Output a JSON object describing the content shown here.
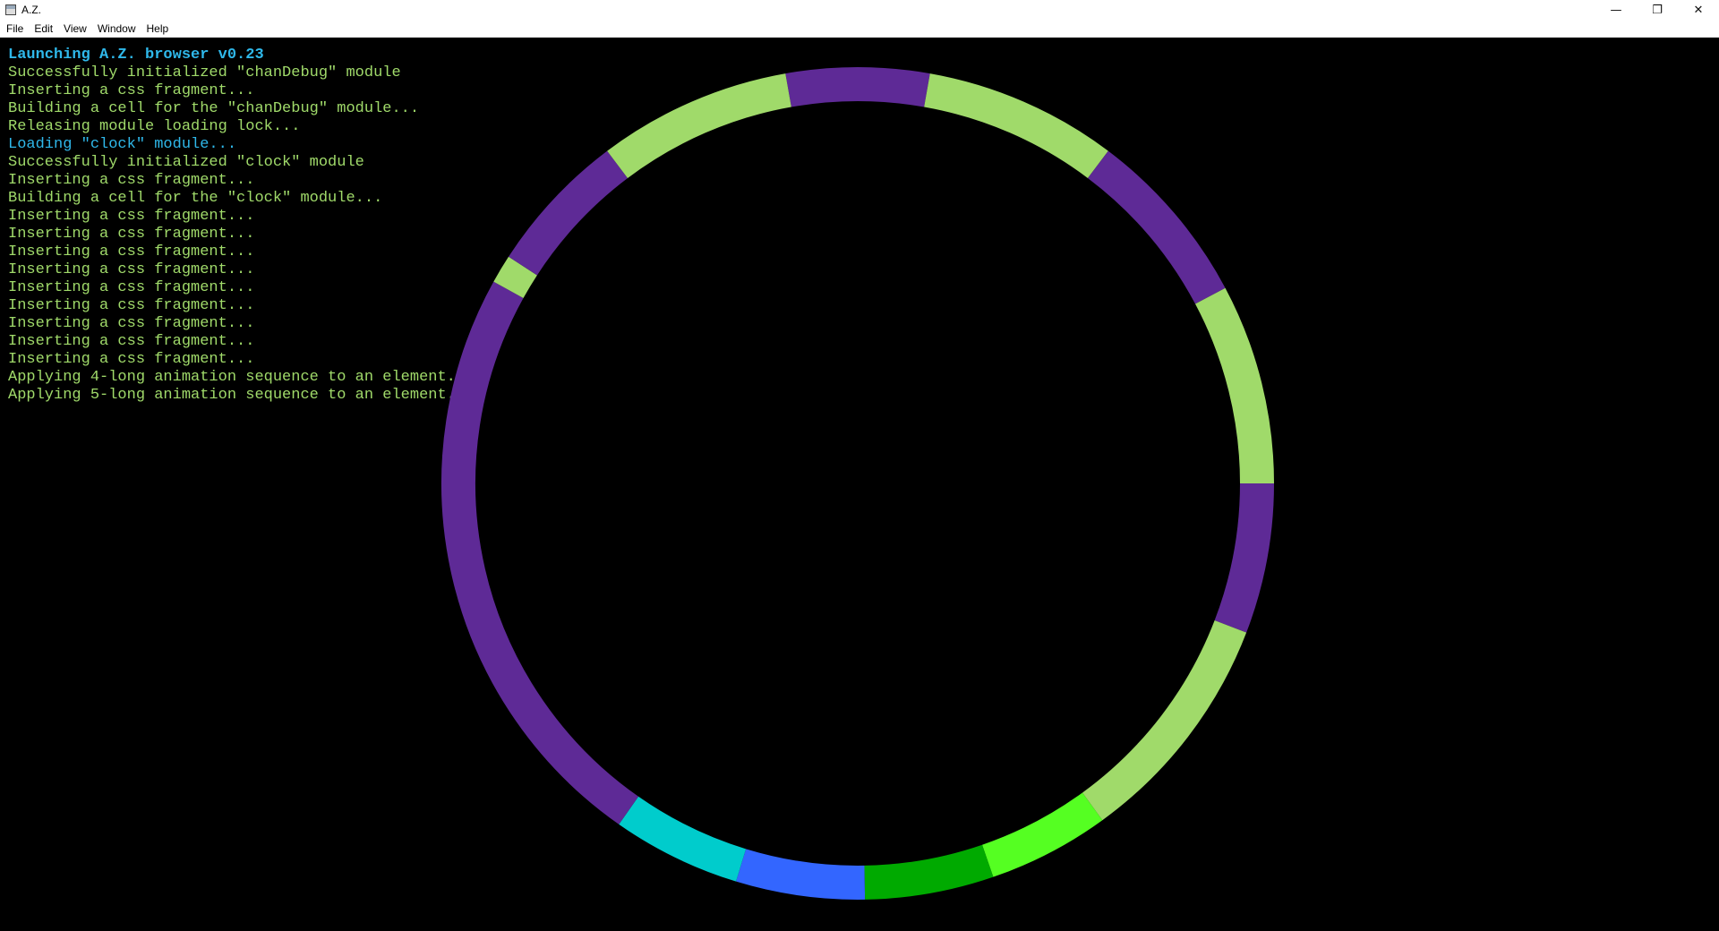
{
  "window": {
    "title": "A.Z.",
    "icon": "app-window-icon",
    "controls": {
      "minimize": "—",
      "restore": "❐",
      "close": "✕"
    }
  },
  "menu": {
    "items": [
      "File",
      "Edit",
      "View",
      "Window",
      "Help"
    ]
  },
  "console": {
    "lines": [
      {
        "text": "Launching A.Z. browser v0.23",
        "kind": "head"
      },
      {
        "text": "Successfully initialized \"chanDebug\" module",
        "kind": "ok"
      },
      {
        "text": "Inserting a css fragment...",
        "kind": "ok"
      },
      {
        "text": "Building a cell for the \"chanDebug\" module...",
        "kind": "ok"
      },
      {
        "text": "Releasing module loading lock...",
        "kind": "ok"
      },
      {
        "text": "Loading \"clock\" module...",
        "kind": "info"
      },
      {
        "text": "Successfully initialized \"clock\" module",
        "kind": "ok"
      },
      {
        "text": "Inserting a css fragment...",
        "kind": "ok"
      },
      {
        "text": "Building a cell for the \"clock\" module...",
        "kind": "ok"
      },
      {
        "text": "Inserting a css fragment...",
        "kind": "ok"
      },
      {
        "text": "Inserting a css fragment...",
        "kind": "ok"
      },
      {
        "text": "Inserting a css fragment...",
        "kind": "ok"
      },
      {
        "text": "Inserting a css fragment...",
        "kind": "ok"
      },
      {
        "text": "Inserting a css fragment...",
        "kind": "ok"
      },
      {
        "text": "Inserting a css fragment...",
        "kind": "ok"
      },
      {
        "text": "Inserting a css fragment...",
        "kind": "ok"
      },
      {
        "text": "Inserting a css fragment...",
        "kind": "ok"
      },
      {
        "text": "Inserting a css fragment...",
        "kind": "ok"
      },
      {
        "text": "Applying 4-long animation sequence to an element...",
        "kind": "ok"
      },
      {
        "text": "Applying 5-long animation sequence to an element...",
        "kind": "ok"
      }
    ]
  },
  "colors": {
    "background": "#000000",
    "console_ok": "#a0da6a",
    "console_info": "#2fb8ea"
  },
  "clock": {
    "segments": [
      {
        "from_deg": -10,
        "to_deg": 10,
        "color": "#5e2a96"
      },
      {
        "from_deg": 10,
        "to_deg": 37,
        "color": "#a0da6a"
      },
      {
        "from_deg": 37,
        "to_deg": 62,
        "color": "#5e2a96"
      },
      {
        "from_deg": 62,
        "to_deg": 90,
        "color": "#a0da6a"
      },
      {
        "from_deg": 90,
        "to_deg": 111,
        "color": "#5e2a96"
      },
      {
        "from_deg": 111,
        "to_deg": 144,
        "color": "#a0da6a"
      },
      {
        "from_deg": 144,
        "to_deg": 161,
        "color": "#55ff22"
      },
      {
        "from_deg": 161,
        "to_deg": 179,
        "color": "#00aa00"
      },
      {
        "from_deg": 179,
        "to_deg": 197,
        "color": "#3366ff"
      },
      {
        "from_deg": 197,
        "to_deg": 215,
        "color": "#00cccc"
      },
      {
        "from_deg": 215,
        "to_deg": 299,
        "color": "#5e2a96"
      },
      {
        "from_deg": 299,
        "to_deg": 303,
        "color": "#a0da6a"
      },
      {
        "from_deg": 303,
        "to_deg": 323,
        "color": "#5e2a96"
      },
      {
        "from_deg": 323,
        "to_deg": 350,
        "color": "#a0da6a"
      }
    ]
  }
}
